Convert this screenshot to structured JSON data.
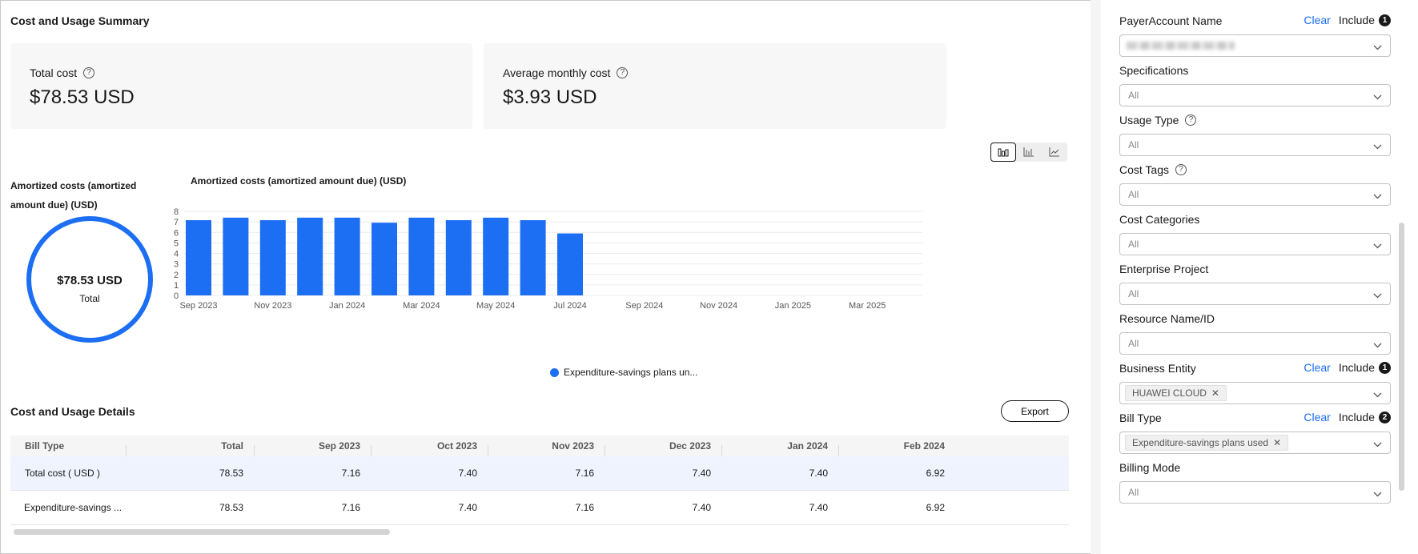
{
  "summary": {
    "title": "Cost and Usage Summary",
    "total_cost_label": "Total cost",
    "total_cost_value": "$78.53 USD",
    "avg_monthly_label": "Average monthly cost",
    "avg_monthly_value": "$3.93 USD"
  },
  "view_toggle": {
    "options": [
      "grouped-bar-chart-icon",
      "stacked-bar-chart-icon",
      "line-chart-icon"
    ],
    "active": 0
  },
  "donut": {
    "title": "Amortized costs (amortized amount due) (USD)",
    "center_value": "$78.53 USD",
    "center_label": "Total"
  },
  "chart_data": {
    "type": "bar",
    "title": "Amortized costs (amortized amount due) (USD)",
    "categories": [
      "Sep 2023",
      "Oct 2023",
      "Nov 2023",
      "Dec 2023",
      "Jan 2024",
      "Feb 2024",
      "Mar 2024",
      "Apr 2024",
      "May 2024",
      "Jun 2024",
      "Jul 2024",
      "Aug 2024",
      "Sep 2024",
      "Oct 2024",
      "Nov 2024",
      "Dec 2024",
      "Jan 2025",
      "Feb 2025",
      "Mar 2025",
      "Apr 2025"
    ],
    "x_tick_labels": [
      "Sep 2023",
      "Nov 2023",
      "Jan 2024",
      "Mar 2024",
      "May 2024",
      "Jul 2024",
      "Sep 2024",
      "Nov 2024",
      "Jan 2025",
      "Mar 2025"
    ],
    "series": [
      {
        "name": "Expenditure-savings plans un...",
        "values": [
          7.16,
          7.4,
          7.16,
          7.4,
          7.4,
          6.92,
          7.4,
          7.16,
          7.4,
          7.16,
          5.9,
          null,
          null,
          null,
          null,
          null,
          null,
          null,
          null,
          null
        ]
      }
    ],
    "ylim": [
      0,
      8
    ],
    "yticks": [
      0,
      1,
      2,
      3,
      4,
      5,
      6,
      7,
      8
    ],
    "grid": true,
    "legend": "bottom",
    "color": "#1c6ef2"
  },
  "details": {
    "title": "Cost and Usage Details",
    "export_label": "Export",
    "columns": [
      "Bill Type",
      "Total",
      "Sep 2023",
      "Oct 2023",
      "Nov 2023",
      "Dec 2023",
      "Jan 2024",
      "Feb 2024"
    ],
    "rows": [
      [
        "Total cost ( USD )",
        "78.53",
        "7.16",
        "7.40",
        "7.16",
        "7.40",
        "7.40",
        "6.92"
      ],
      [
        "Expenditure-savings ...",
        "78.53",
        "7.16",
        "7.40",
        "7.16",
        "7.40",
        "7.40",
        "6.92"
      ]
    ]
  },
  "filters": [
    {
      "label": "PayerAccount Name",
      "value": "",
      "placeholder": "",
      "clear": "Clear",
      "include": "Include",
      "count": "1",
      "redacted": true
    },
    {
      "label": "Specifications",
      "value": "All"
    },
    {
      "label": "Usage Type",
      "value": "All",
      "help": true
    },
    {
      "label": "Cost Tags",
      "value": "All",
      "help": true
    },
    {
      "label": "Cost Categories",
      "value": "All"
    },
    {
      "label": "Enterprise Project",
      "value": "All"
    },
    {
      "label": "Resource Name/ID",
      "value": "All"
    },
    {
      "label": "Business Entity",
      "tag": "HUAWEI CLOUD",
      "clear": "Clear",
      "include": "Include",
      "count": "1"
    },
    {
      "label": "Bill Type",
      "tag": "Expenditure-savings plans used",
      "clear": "Clear",
      "include": "Include",
      "count": "2"
    },
    {
      "label": "Billing Mode",
      "value": "All"
    }
  ],
  "colors": {
    "accent": "#1c6ef2",
    "card_bg": "#f7f7f7",
    "row_highlight": "#eef3fe"
  }
}
